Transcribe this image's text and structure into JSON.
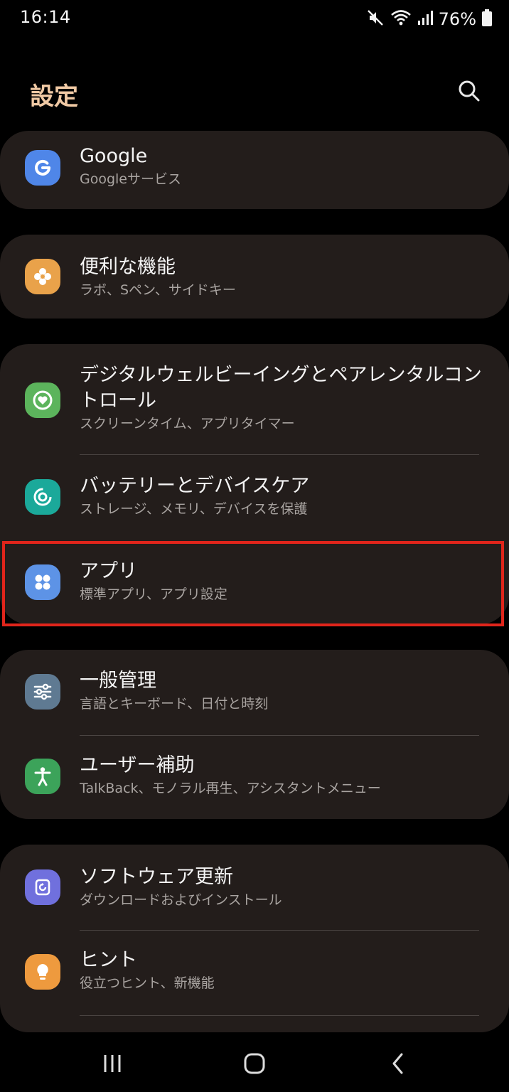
{
  "status_bar": {
    "time": "16:14",
    "battery": "76%",
    "icons": [
      "mute-icon",
      "wifi-icon",
      "signal-icon",
      "battery-icon"
    ]
  },
  "header": {
    "title": "設定",
    "search_icon": "search-icon"
  },
  "colors": {
    "background": "#000000",
    "card": "#231d1b",
    "title_accent": "#f0c9a4",
    "highlight": "#e0251b"
  },
  "sections": [
    {
      "items": [
        {
          "title": "Google",
          "subtitle": "Googleサービス",
          "icon": "google-icon",
          "icon_color": "#4f86e8"
        }
      ]
    },
    {
      "items": [
        {
          "title": "便利な機能",
          "subtitle": "ラボ、Sペン、サイドキー",
          "icon": "puzzle-icon",
          "icon_color": "#e9a24a"
        }
      ]
    },
    {
      "items": [
        {
          "title": "デジタルウェルビーイングとペアレンタルコントロール",
          "subtitle": "スクリーンタイム、アプリタイマー",
          "icon": "wellbeing-heart-icon",
          "icon_color": "#5cb45c"
        },
        {
          "title": "バッテリーとデバイスケア",
          "subtitle": "ストレージ、メモリ、デバイスを保護",
          "icon": "device-care-icon",
          "icon_color": "#1ba99a"
        },
        {
          "title": "アプリ",
          "subtitle": "標準アプリ、アプリ設定",
          "icon": "apps-grid-icon",
          "icon_color": "#5d93e6",
          "highlighted": true
        }
      ]
    },
    {
      "items": [
        {
          "title": "一般管理",
          "subtitle": "言語とキーボード、日付と時刻",
          "icon": "sliders-icon",
          "icon_color": "#5f7a92"
        },
        {
          "title": "ユーザー補助",
          "subtitle": "TalkBack、モノラル再生、アシスタントメニュー",
          "icon": "accessibility-icon",
          "icon_color": "#3ca35a"
        }
      ]
    },
    {
      "items": [
        {
          "title": "ソフトウェア更新",
          "subtitle": "ダウンロードおよびインストール",
          "icon": "software-update-icon",
          "icon_color": "#7070dd"
        },
        {
          "title": "ヒント",
          "subtitle": "役立つヒント、新機能",
          "icon": "lightbulb-icon",
          "icon_color": "#ee9a3e"
        }
      ]
    }
  ],
  "nav_bar": {
    "buttons": [
      "recents-icon",
      "home-icon",
      "back-icon"
    ]
  }
}
